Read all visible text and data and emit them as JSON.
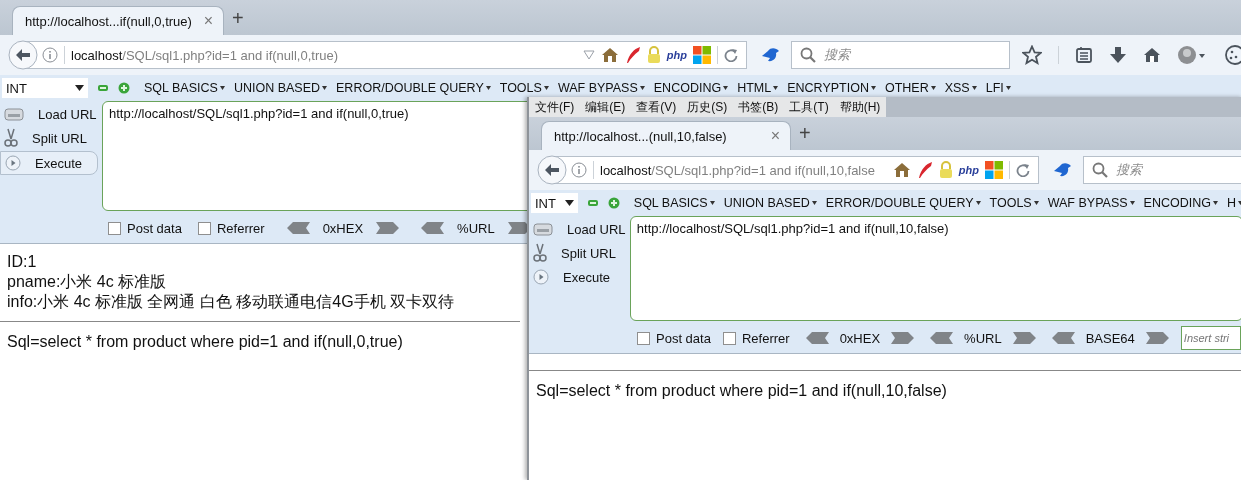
{
  "windows": [
    {
      "kind": "back",
      "tabs": [
        {
          "title": "http://localhost...if(null,0,true)",
          "close": "×",
          "selected": true
        }
      ],
      "new_tab": "+",
      "address": {
        "host": "localhost",
        "path": "/SQL/sql1.php?id=1 and if(null,0,true)",
        "badge": "php"
      },
      "search": {
        "placeholder": "搜索"
      },
      "hackbar": {
        "type_select": "INT",
        "menus": [
          "SQL BASICS",
          "UNION BASED",
          "ERROR/DOUBLE QUERY",
          "TOOLS",
          "WAF BYPASS",
          "ENCODING",
          "HTML",
          "ENCRYPTION",
          "OTHER",
          "XSS",
          "LFI"
        ],
        "actions": [
          {
            "label": "Load URL",
            "kind": "load",
            "highlighted": false
          },
          {
            "label": "Split URL",
            "kind": "split",
            "highlighted": false
          },
          {
            "label": "Execute",
            "kind": "execute",
            "highlighted": true
          }
        ],
        "url": "http://localhost/SQL/sql1.php?id=1 and if(null,0,true)",
        "options": [
          {
            "label": "Post data",
            "checked": false
          },
          {
            "label": "Referrer",
            "checked": false
          }
        ],
        "encoders": [
          "0xHEX",
          "%URL"
        ]
      },
      "page": {
        "lines": [
          "ID:1",
          "pname:小米 4c 标准版",
          "info:小米 4c 标准版 全网通 白色 移动联通电信4G手机 双卡双待"
        ],
        "sql": "Sql=select * from product where pid=1 and if(null,0,true)"
      }
    },
    {
      "kind": "front",
      "menu_bar": [
        "文件(F)",
        "编辑(E)",
        "查看(V)",
        "历史(S)",
        "书签(B)",
        "工具(T)",
        "帮助(H)"
      ],
      "tabs": [
        {
          "title": "http://localhost...(null,10,false)",
          "close": "×",
          "selected": true
        }
      ],
      "new_tab": "+",
      "address": {
        "host": "localhost",
        "path": "/SQL/sql1.php?id=1 and if(null,10,false",
        "badge": "php"
      },
      "search": {
        "placeholder": "搜索"
      },
      "hackbar": {
        "type_select": "INT",
        "menus": [
          "SQL BASICS",
          "UNION BASED",
          "ERROR/DOUBLE QUERY",
          "TOOLS",
          "WAF BYPASS",
          "ENCODING",
          "H"
        ],
        "actions": [
          {
            "label": "Load URL",
            "kind": "load",
            "highlighted": false
          },
          {
            "label": "Split URL",
            "kind": "split",
            "highlighted": false
          },
          {
            "label": "Execute",
            "kind": "execute",
            "highlighted": false
          }
        ],
        "url": "http://localhost/SQL/sql1.php?id=1 and if(null,10,false)",
        "options": [
          {
            "label": "Post data",
            "checked": false
          },
          {
            "label": "Referrer",
            "checked": false
          }
        ],
        "encoders": [
          "0xHEX",
          "%URL",
          "BASE64"
        ],
        "insert_placeholder": "Insert stri"
      },
      "page": {
        "sql": "Sql=select * from product where pid=1 and if(null,10,false)"
      }
    }
  ]
}
